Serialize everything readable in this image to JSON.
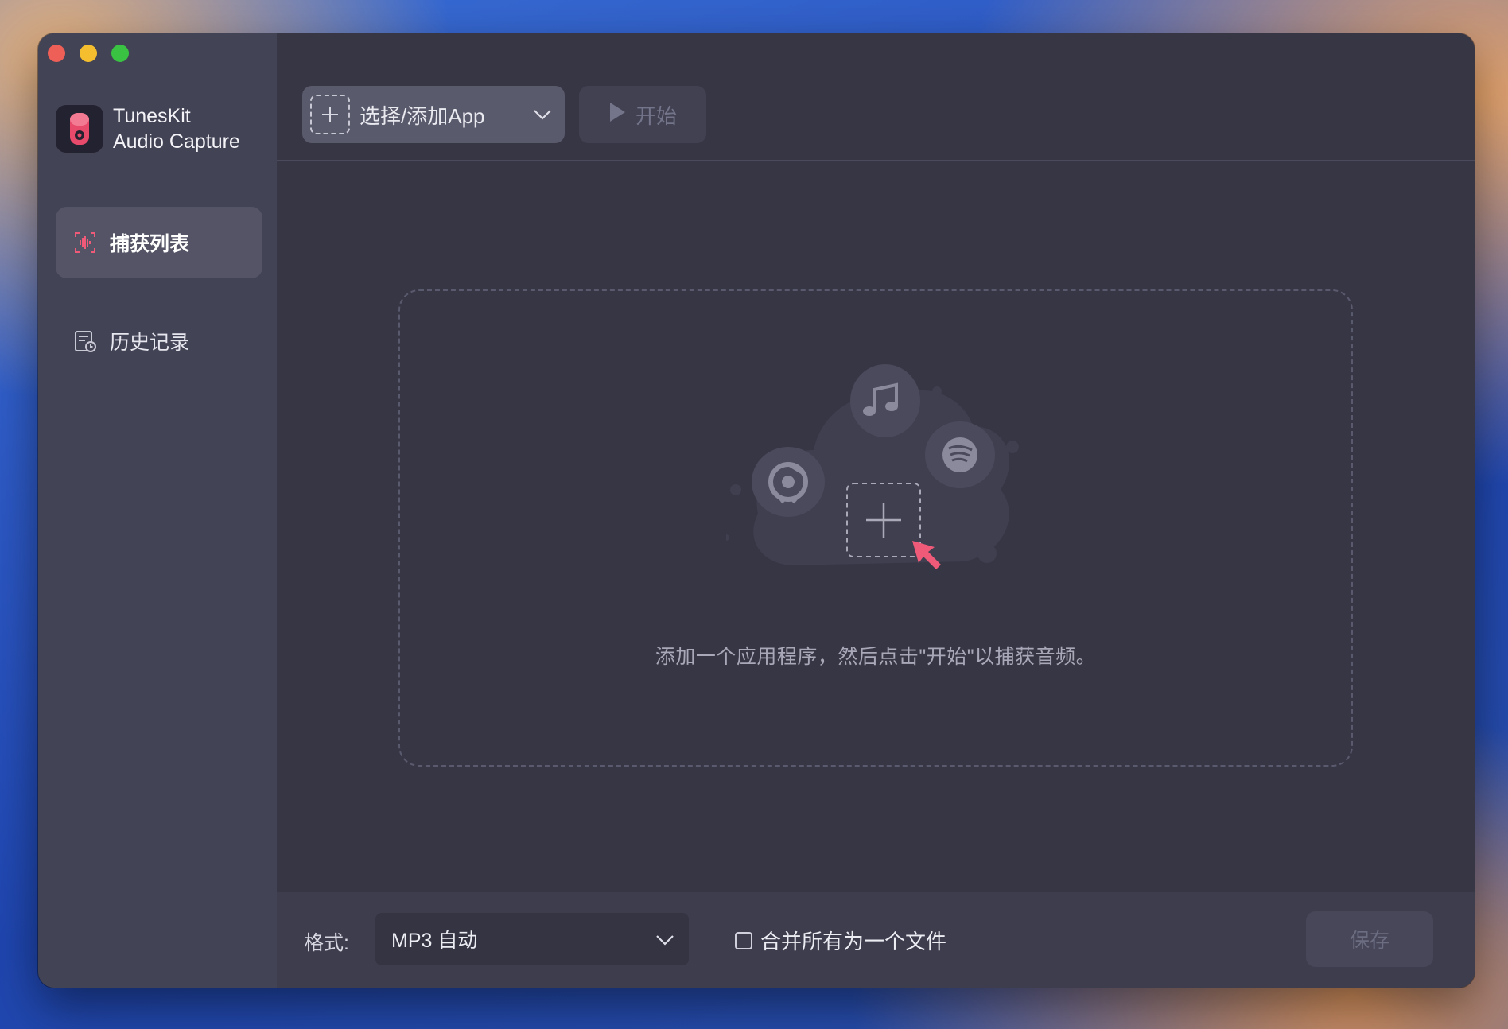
{
  "window": {
    "controls": [
      "close",
      "minimize",
      "maximize"
    ]
  },
  "brand": {
    "line1": "TunesKit",
    "line2": "Audio Capture",
    "icon": "microphone-logo-icon"
  },
  "sidebar": {
    "items": [
      {
        "label": "捕获列表",
        "icon": "waveform-icon",
        "active": true
      },
      {
        "label": "历史记录",
        "icon": "history-icon",
        "active": false
      }
    ]
  },
  "toolbar": {
    "add_app_label": "选择/添加App",
    "start_label": "开始"
  },
  "dropzone": {
    "hint": "添加一个应用程序，然后点击\"开始\"以捕获音频。",
    "app_icons": [
      "music-note-icon",
      "chrome-icon",
      "spotify-icon",
      "plus-icon",
      "cursor-arrow-icon"
    ]
  },
  "footer": {
    "format_label": "格式:",
    "format_value": "MP3 自动",
    "merge_label": "合并所有为一个文件",
    "merge_checked": false,
    "save_label": "保存"
  },
  "colors": {
    "accent": "#ef5a78",
    "sidebar_bg": "#434356",
    "main_bg": "#363645"
  }
}
